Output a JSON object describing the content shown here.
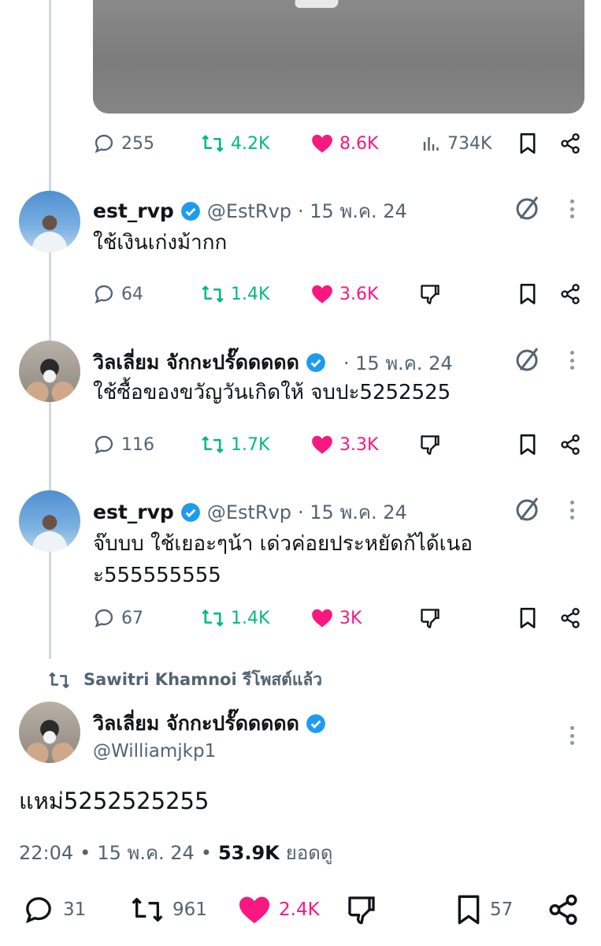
{
  "top_post_stats": {
    "replies": "255",
    "reposts": "4.2K",
    "likes": "8.6K",
    "views": "734K"
  },
  "replies": [
    {
      "name": "est_rvp",
      "handle": "@EstRvp",
      "date": "· 15 พ.ค. 24",
      "text": "ใช้เงินเก่งม้ากก",
      "stats": {
        "replies": "64",
        "reposts": "1.4K",
        "likes": "3.6K"
      }
    },
    {
      "name": "วิลเลี่ยม จักกะปรั๊ดดดดด",
      "handle": "",
      "date": "· 15 พ.ค. 24",
      "text": "ใช้ซื้อของขวัญวันเกิดให้ จบปะ5252525",
      "stats": {
        "replies": "116",
        "reposts": "1.7K",
        "likes": "3.3K"
      }
    },
    {
      "name": "est_rvp",
      "handle": "@EstRvp",
      "date": "· 15 พ.ค. 24",
      "text_line1": "จ๊บบบ ใช้เยอะๆน้า เด่วค่อยประหยัดก้ได้เนอ",
      "text_line2": "ะ555555555",
      "stats": {
        "replies": "67",
        "reposts": "1.4K",
        "likes": "3K"
      }
    }
  ],
  "repost_banner": "Sawitri Khamnoi รีโพสต์แล้ว",
  "main_post": {
    "name": "วิลเลี่ยม จักกะปรั๊ดดดดด",
    "handle": "@Williamjkp1",
    "text": "แหม่5252525255",
    "time": "22:04",
    "date": "15 พ.ค. 24",
    "views": "53.9K",
    "views_label": "ยอดดู",
    "stats": {
      "replies": "31",
      "reposts": "961",
      "likes": "2.4K",
      "bookmarks": "57"
    }
  },
  "colors": {
    "accent_like": "#f91880",
    "accent_repost": "#00ba7c",
    "verified": "#1d9bf0",
    "muted": "#536471"
  }
}
